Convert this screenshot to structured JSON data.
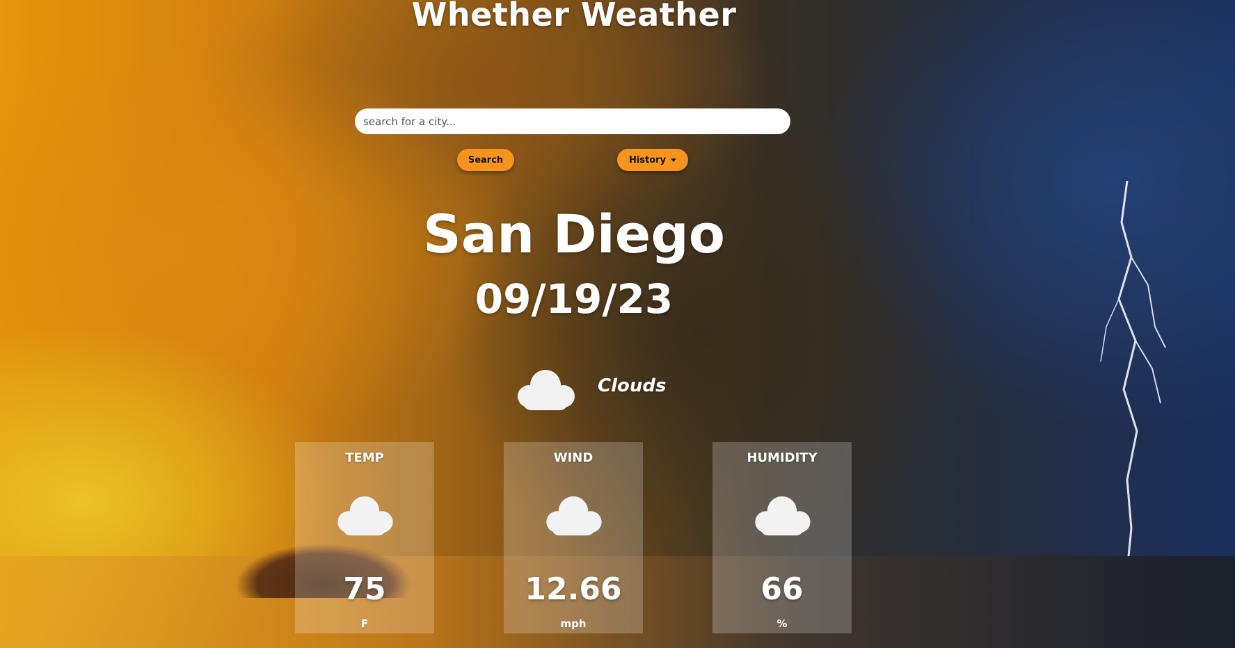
{
  "app": {
    "title": "Whether Weather"
  },
  "search": {
    "placeholder": "search for a city...",
    "value": "",
    "search_label": "Search",
    "history_label": "History"
  },
  "current": {
    "city": "San Diego",
    "date": "09/19/23",
    "condition": "Clouds",
    "condition_icon": "cloud-icon"
  },
  "cards": [
    {
      "title": "TEMP",
      "icon": "cloud-icon",
      "value": "75",
      "unit": "F"
    },
    {
      "title": "WIND",
      "icon": "cloud-icon",
      "value": "12.66",
      "unit": "mph"
    },
    {
      "title": "HUMIDITY",
      "icon": "cloud-icon",
      "value": "66",
      "unit": "%"
    }
  ],
  "colors": {
    "accent": "#f7941d",
    "text": "#ffffff",
    "card_bg": "rgba(255,255,255,0.22)"
  }
}
